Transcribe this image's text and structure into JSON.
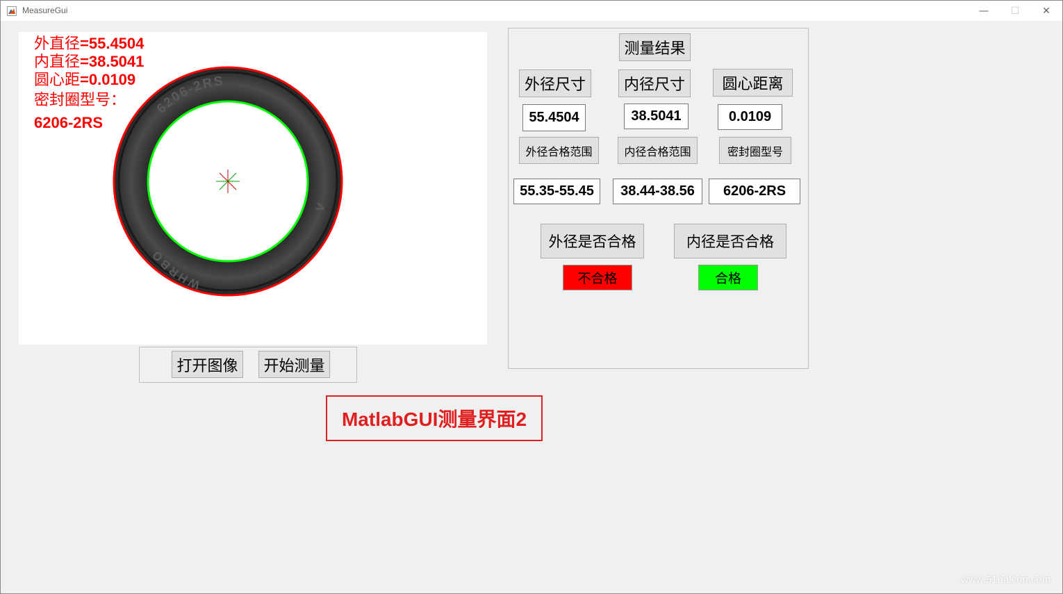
{
  "window": {
    "title": "MeasureGui",
    "minimize_glyph": "—",
    "maximize_glyph": "☐",
    "close_glyph": "✕",
    "icon": "matlab-icon"
  },
  "image_overlay": {
    "outer_label": "外直径",
    "outer_value": "=55.4504",
    "inner_label": "内直径",
    "inner_value": "=38.5041",
    "center_label": "圆心距",
    "center_value": "=0.0109",
    "model_label": "密封圈型号：",
    "model_value": "6206-2RS",
    "ring_print_top": "6206-2RS",
    "ring_print_bottom": "WHRBO",
    "ring_print_side": "V"
  },
  "actions": {
    "open_image": "打开图像",
    "start_measure": "开始测量"
  },
  "results": {
    "title": "测量结果",
    "outer_label": "外径尺寸",
    "inner_label": "内径尺寸",
    "center_label": "圆心距离",
    "outer_value": "55.4504",
    "inner_value": "38.5041",
    "center_value": "0.0109",
    "outer_range_label": "外径合格范围",
    "inner_range_label": "内径合格范围",
    "model_label": "密封圈型号",
    "outer_range": "55.35-55.45",
    "inner_range": "38.44-38.56",
    "model_value": "6206-2RS",
    "outer_check_label": "外径是否合格",
    "inner_check_label": "内径是否合格",
    "outer_status": "不合格",
    "inner_status": "合格"
  },
  "colors": {
    "fail": "#ff0000",
    "pass": "#00ff00",
    "outer_circle": "#ff0000",
    "inner_circle": "#00ff00"
  },
  "caption": "MatlabGUI测量界面2",
  "watermark": "www.51halcon.com"
}
